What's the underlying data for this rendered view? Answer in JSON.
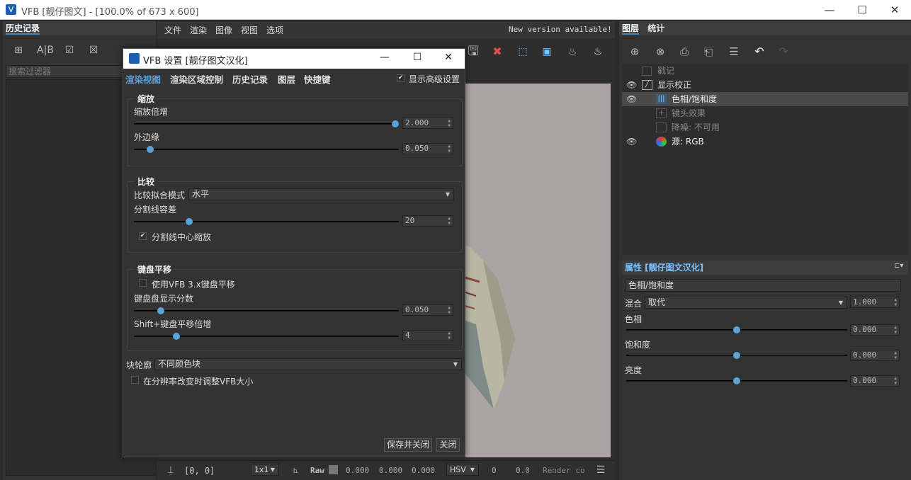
{
  "window": {
    "title": "VFB [靓仔图文] - [100.0% of 673 x 600]",
    "app_icon": "V"
  },
  "history": {
    "title": "历史记录",
    "filter_placeholder": "搜索过滤器"
  },
  "menu": [
    "文件",
    "渲染",
    "图像",
    "视图",
    "选项"
  ],
  "update_notice": "New version available!",
  "statusbar": {
    "coords": "[0, 0]",
    "zoom": "1x1",
    "raw": "Raw",
    "v1": "0.000",
    "v2": "0.000",
    "v3": "0.000",
    "mode": "HSV",
    "h": "0",
    "s": "0.0",
    "render": "Render co"
  },
  "layers": {
    "tabs": [
      "图层",
      "统计"
    ],
    "items": [
      {
        "label": "戳记",
        "eye": false,
        "dim": true,
        "indent": false
      },
      {
        "label": "显示校正",
        "eye": true,
        "dim": false,
        "indent": false
      },
      {
        "label": "色相/饱和度",
        "eye": true,
        "dim": false,
        "indent": true
      },
      {
        "label": "镜头效果",
        "eye": false,
        "dim": true,
        "indent": true
      },
      {
        "label": "降噪: 不可用",
        "eye": false,
        "dim": true,
        "indent": true
      },
      {
        "label": "源: RGB",
        "eye": true,
        "dim": false,
        "indent": false
      }
    ]
  },
  "props": {
    "title": "属性 [靓仔图文汉化]",
    "name": "色相/饱和度",
    "blend_label": "混合",
    "blend_value": "取代",
    "blend_amount": "1.000",
    "sliders": [
      {
        "label": "色相",
        "value": "0.000",
        "level": 0.5
      },
      {
        "label": "饱和度",
        "value": "0.000",
        "level": 0.5
      },
      {
        "label": "亮度",
        "value": "0.000",
        "level": 0.5
      }
    ]
  },
  "dialog": {
    "title": "VFB 设置 [靓仔图文汉化]",
    "tabs": [
      "渲染视图",
      "渲染区域控制",
      "历史记录",
      "图层",
      "快捷键"
    ],
    "advanced": "显示高级设置",
    "zoom_group": "缩放",
    "zoom_mult_label": "缩放倍增",
    "zoom_mult_value": "2.000",
    "zoom_mult_level": 1.0,
    "outer_label": "外边缘",
    "outer_value": "0.050",
    "outer_level": 0.05,
    "compare_group": "比较",
    "fit_label": "比较拟合模式",
    "fit_value": "水平",
    "split_label": "分割线容差",
    "split_value": "20",
    "split_level": 0.2,
    "split_center": "分割线中心缩放",
    "pan_group": "键盘平移",
    "use_vfb3": "使用VFB 3.x键盘平移",
    "pan_fraction_label": "键盘盘显示分数",
    "pan_fraction_value": "0.050",
    "pan_fraction_level": 0.09,
    "shift_label": "Shift+键盘平移倍增",
    "shift_value": "4",
    "shift_level": 0.15,
    "outline_label": "块轮廓",
    "outline_value": "不同颜色块",
    "resize_label": "在分辨率改变时调整VFB大小",
    "save_close": "保存并关闭",
    "close": "关闭"
  }
}
